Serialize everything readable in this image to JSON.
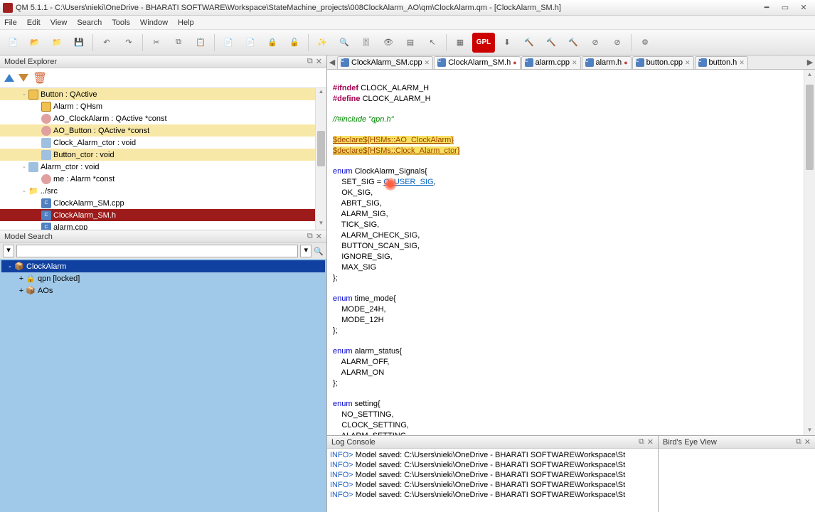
{
  "titlebar": {
    "title": "QM 5.1.1 - C:\\Users\\nieki\\OneDrive - BHARATI SOFTWARE\\Workspace\\StateMachine_projects\\008ClockAlarm_AO\\qm\\ClockAlarm.qm - [ClockAlarm_SM.h]"
  },
  "menubar": [
    "File",
    "Edit",
    "View",
    "Search",
    "Tools",
    "Window",
    "Help"
  ],
  "panels": {
    "explorer": "Model Explorer",
    "search": "Model Search",
    "log": "Log Console",
    "bird": "Bird's Eye View"
  },
  "toolbar_icons": [
    "new",
    "open",
    "folder",
    "save",
    "|",
    "undo",
    "redo",
    "|",
    "cut",
    "copy",
    "paste",
    "|",
    "doc-add",
    "doc-del",
    "lock",
    "unlock",
    "|",
    "wand",
    "search",
    "tune",
    "eye",
    "layout",
    "cursor",
    "|",
    "grid",
    "gpl",
    "dl",
    "build1",
    "build2",
    "build3",
    "stop",
    "stop2",
    "|",
    "gear"
  ],
  "explorer_items": [
    {
      "lvl": 1,
      "exp": "-",
      "ic": "class",
      "label": "Button : QActive",
      "hl": "yel"
    },
    {
      "lvl": 2,
      "exp": "",
      "ic": "class",
      "label": "Alarm : QHsm"
    },
    {
      "lvl": 2,
      "exp": "",
      "ic": "attr",
      "label": "AO_ClockAlarm : QActive *const"
    },
    {
      "lvl": 2,
      "exp": "",
      "ic": "attr",
      "label": "AO_Button : QActive *const",
      "hl": "yel"
    },
    {
      "lvl": 2,
      "exp": "",
      "ic": "op",
      "label": "Clock_Alarm_ctor : void"
    },
    {
      "lvl": 2,
      "exp": "",
      "ic": "op",
      "label": "Button_ctor : void",
      "hl": "yel"
    },
    {
      "lvl": 1,
      "exp": "-",
      "ic": "op",
      "label": "Alarm_ctor : void"
    },
    {
      "lvl": 2,
      "exp": "",
      "ic": "attr",
      "label": "me : Alarm *const"
    },
    {
      "lvl": 1,
      "exp": "-",
      "ic": "fold",
      "label": "../src"
    },
    {
      "lvl": 2,
      "exp": "",
      "ic": "cpp",
      "label": "ClockAlarm_SM.cpp"
    },
    {
      "lvl": 2,
      "exp": "",
      "ic": "cpp",
      "label": "ClockAlarm_SM.h",
      "hl": "red"
    },
    {
      "lvl": 2,
      "exp": "",
      "ic": "cpp",
      "label": "alarm.cpp"
    },
    {
      "lvl": 2,
      "exp": "",
      "ic": "cpp",
      "label": "alarm.h"
    }
  ],
  "search_items": [
    {
      "lvl": 0,
      "exp": "-",
      "ic": "pkg",
      "label": "ClockAlarm",
      "sel": true
    },
    {
      "lvl": 1,
      "exp": "+",
      "ic": "lock",
      "label": "qpn [locked]"
    },
    {
      "lvl": 1,
      "exp": "+",
      "ic": "pkg",
      "label": "AOs"
    }
  ],
  "tabs": [
    {
      "label": "ClockAlarm_SM.cpp",
      "active": false,
      "mod": false
    },
    {
      "label": "ClockAlarm_SM.h",
      "active": true,
      "mod": true
    },
    {
      "label": "alarm.cpp",
      "active": false,
      "mod": false
    },
    {
      "label": "alarm.h",
      "active": false,
      "mod": true
    },
    {
      "label": "button.cpp",
      "active": false,
      "mod": false
    },
    {
      "label": "button.h",
      "active": false,
      "mod": false
    }
  ],
  "code": {
    "l1a": "#ifndef",
    "l1b": " CLOCK_ALARM_H",
    "l2a": "#define",
    "l2b": " CLOCK_ALARM_H",
    "l3": "//#include \"qpn.h\"",
    "l4": "$declare${HSMs::AO_ClockAlarm}",
    "l5": "$declare${HSMs::Clock_Alarm_ctor}",
    "l6a": "enum",
    "l6b": " ClockAlarm_Signals{",
    "l7a": "    SET_SIG = ",
    "l7b": "Q_USER_SIG",
    "l7c": ",",
    "l8": "    OK_SIG,",
    "l9": "    ABRT_SIG,",
    "l10": "    ALARM_SIG,",
    "l11": "    TICK_SIG,",
    "l12": "    ALARM_CHECK_SIG,",
    "l13": "    BUTTON_SCAN_SIG,",
    "l14": "    IGNORE_SIG,",
    "l15": "    MAX_SIG",
    "l16": "};",
    "l17a": "enum",
    "l17b": " time_mode{",
    "l18": "    MODE_24H,",
    "l19": "    MODE_12H",
    "l20": "};",
    "l21a": "enum",
    "l21b": " alarm_status{",
    "l22": "    ALARM_OFF,",
    "l23": "    ALARM_ON",
    "l24": "};",
    "l25a": "enum",
    "l25b": " setting{",
    "l26": "    NO_SETTING,",
    "l27": "    CLOCK_SETTING,",
    "l28": "    ALARM_SETTING",
    "l29": "};"
  },
  "log_lines": [
    "INFO> Model saved: C:\\Users\\nieki\\OneDrive - BHARATI SOFTWARE\\Workspace\\St",
    "INFO> Model saved: C:\\Users\\nieki\\OneDrive - BHARATI SOFTWARE\\Workspace\\St",
    "INFO> Model saved: C:\\Users\\nieki\\OneDrive - BHARATI SOFTWARE\\Workspace\\St",
    "INFO> Model saved: C:\\Users\\nieki\\OneDrive - BHARATI SOFTWARE\\Workspace\\St",
    "INFO> Model saved: C:\\Users\\nieki\\OneDrive - BHARATI SOFTWARE\\Workspace\\St"
  ],
  "gpl_label": "GPL"
}
